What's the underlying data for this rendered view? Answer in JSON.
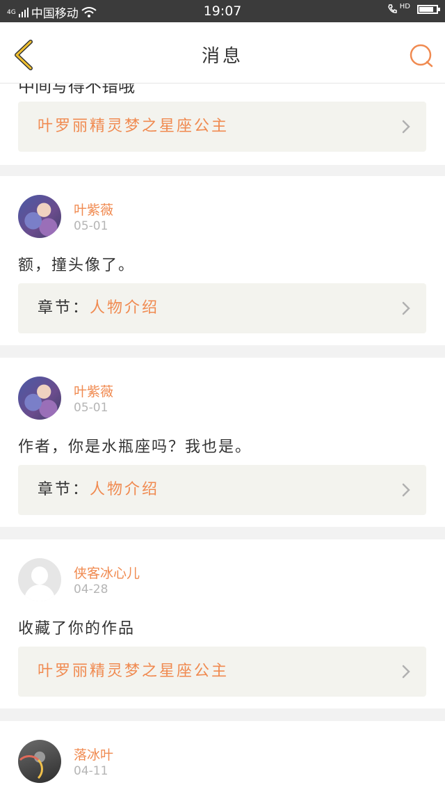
{
  "status_bar": {
    "carrier": "中国移动",
    "network": "4G",
    "time": "19:07",
    "hd_label": "HD"
  },
  "header": {
    "title": "消息"
  },
  "partial_item": {
    "comment_text": "中间写得不错哦"
  },
  "messages": [
    {
      "ref": {
        "title": "叶罗丽精灵梦之星座公主"
      }
    },
    {
      "username": "叶紫薇",
      "date": "05-01",
      "comment": "额，撞头像了。",
      "ref": {
        "prefix": "章节：",
        "title": "人物介绍"
      }
    },
    {
      "username": "叶紫薇",
      "date": "05-01",
      "comment": "作者，你是水瓶座吗？我也是。",
      "ref": {
        "prefix": "章节：",
        "title": "人物介绍"
      }
    },
    {
      "username": "侠客冰心儿",
      "date": "04-28",
      "comment": "收藏了你的作品",
      "ref": {
        "title": "叶罗丽精灵梦之星座公主"
      }
    },
    {
      "username": "落冰叶",
      "date": "04-11"
    }
  ],
  "colors": {
    "accent": "#f08a50",
    "back_icon": "#f0c030",
    "status_bar": "#3b3b3b",
    "ref_box_bg": "#f3f3ee",
    "divider": "#f2f2f2"
  }
}
